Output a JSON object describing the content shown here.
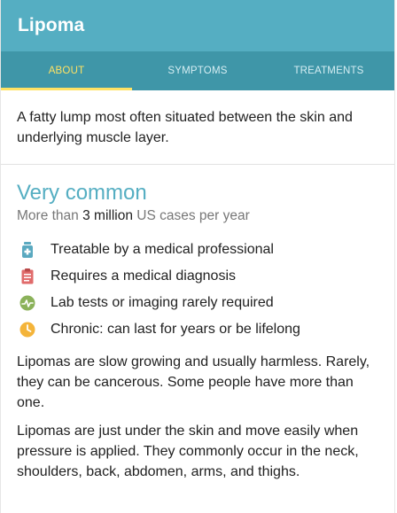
{
  "header": {
    "title": "Lipoma"
  },
  "tabs": [
    {
      "label": "ABOUT",
      "active": true
    },
    {
      "label": "SYMPTOMS",
      "active": false
    },
    {
      "label": "TREATMENTS",
      "active": false
    }
  ],
  "description": "A fatty lump most often situated between the skin and underlying muscle layer.",
  "prevalence": {
    "heading": "Very common",
    "prefix": "More than ",
    "count": "3 million",
    "suffix": " US cases per year"
  },
  "facts": [
    {
      "icon": "medicine-bottle-icon",
      "color": "#5aa9c0",
      "text": "Treatable by a medical professional"
    },
    {
      "icon": "clipboard-icon",
      "color": "#e06b6b",
      "text": "Requires a medical diagnosis"
    },
    {
      "icon": "lab-test-icon",
      "color": "#8bb25a",
      "text": "Lab tests or imaging rarely required"
    },
    {
      "icon": "clock-icon",
      "color": "#f4b43a",
      "text": "Chronic: can last for years or be lifelong"
    }
  ],
  "paragraphs": [
    "Lipomas are slow growing and usually harmless. Rarely, they can be cancerous. Some people have more than one.",
    "Lipomas are just under the skin and move easily when pressure is applied. They commonly occur in the neck, shoulders, back, abdomen, arms, and thighs."
  ],
  "colors": {
    "header": "#55aec2",
    "tabs": "#3f96a8",
    "active_tab": "#ffe263",
    "accent": "#55aec2"
  }
}
